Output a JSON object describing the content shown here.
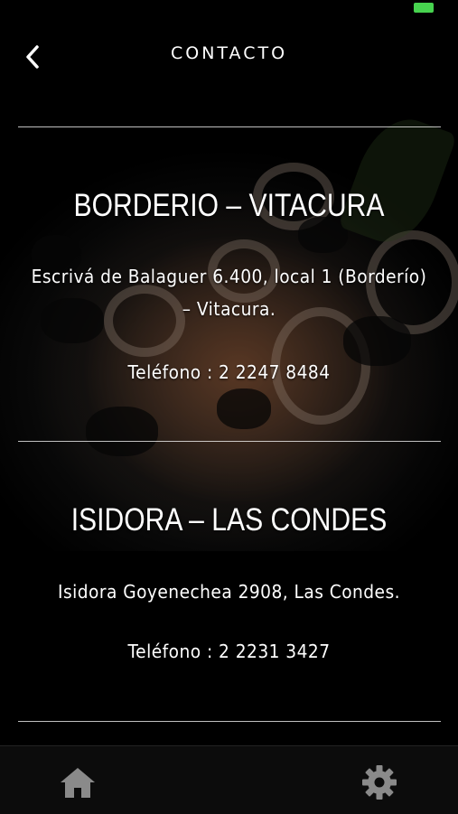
{
  "header": {
    "title": "CONTACTO",
    "back_icon": "chevron-left-icon"
  },
  "status": {
    "indicator_color": "#47d34f"
  },
  "branches": [
    {
      "name": "BORDERIO – VITACURA",
      "address_line1": "Escrivá de Balaguer 6.400, local 1 (Borderío)",
      "address_line2": "– Vitacura.",
      "phone": "Teléfono : 2 2247 8484"
    },
    {
      "name": "ISIDORA – LAS CONDES",
      "address_line1": "Isidora Goyenechea 2908, Las Condes.",
      "phone": "Teléfono : 2 2231 3427"
    }
  ],
  "tab_bar": {
    "items": [
      {
        "icon": "home-icon"
      },
      {
        "icon": "gear-icon"
      }
    ],
    "icon_color": "#8a8a8a"
  }
}
